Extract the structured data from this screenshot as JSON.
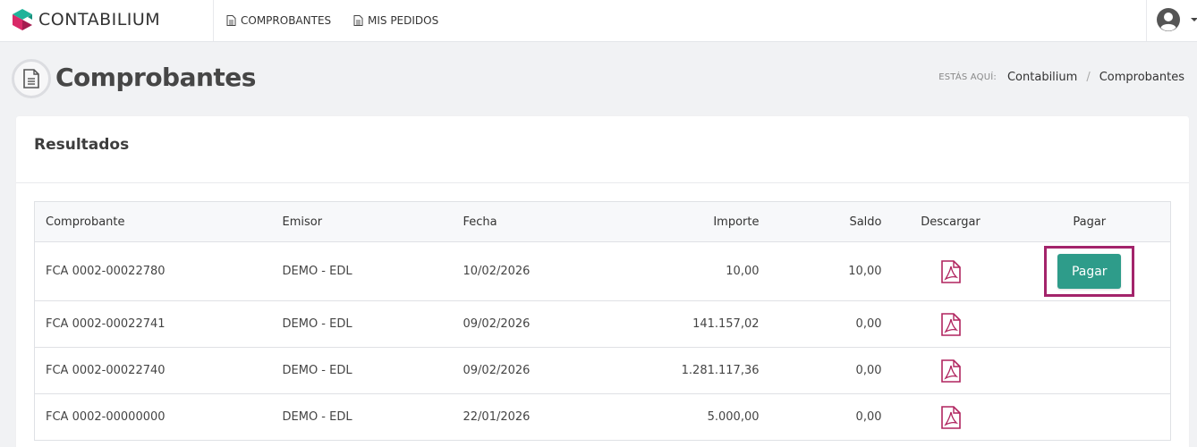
{
  "brand": {
    "name": "CONTABILIUM"
  },
  "nav": {
    "items": [
      {
        "label": "COMPROBANTES"
      },
      {
        "label": "MIS PEDIDOS"
      }
    ]
  },
  "page": {
    "title": "Comprobantes"
  },
  "breadcrumb": {
    "label": "ESTÁS AQUÍ:",
    "items": [
      "Contabilium",
      "Comprobantes"
    ],
    "separator": "/"
  },
  "card": {
    "title": "Resultados"
  },
  "table": {
    "headers": [
      "Comprobante",
      "Emisor",
      "Fecha",
      "Importe",
      "Saldo",
      "Descargar",
      "Pagar"
    ],
    "rows": [
      {
        "comprobante": "FCA 0002-00022780",
        "emisor": "DEMO - EDL",
        "fecha": "10/02/2026",
        "importe": "10,00",
        "saldo": "10,00",
        "pay_label": "Pagar"
      },
      {
        "comprobante": "FCA 0002-00022741",
        "emisor": "DEMO - EDL",
        "fecha": "09/02/2026",
        "importe": "141.157,02",
        "saldo": "0,00"
      },
      {
        "comprobante": "FCA 0002-00022740",
        "emisor": "DEMO - EDL",
        "fecha": "09/02/2026",
        "importe": "1.281.117,36",
        "saldo": "0,00"
      },
      {
        "comprobante": "FCA 0002-00000000",
        "emisor": "DEMO - EDL",
        "fecha": "22/01/2026",
        "importe": "5.000,00",
        "saldo": "0,00"
      }
    ]
  },
  "icons": {
    "logo": "contabilium-logo-icon",
    "nav_doc": "document-icon",
    "user": "user-circle-icon",
    "pdf": "pdf-icon"
  },
  "colors": {
    "accent": "#2e9c8a",
    "highlight": "#a3246b",
    "pdf": "#b0245f"
  }
}
